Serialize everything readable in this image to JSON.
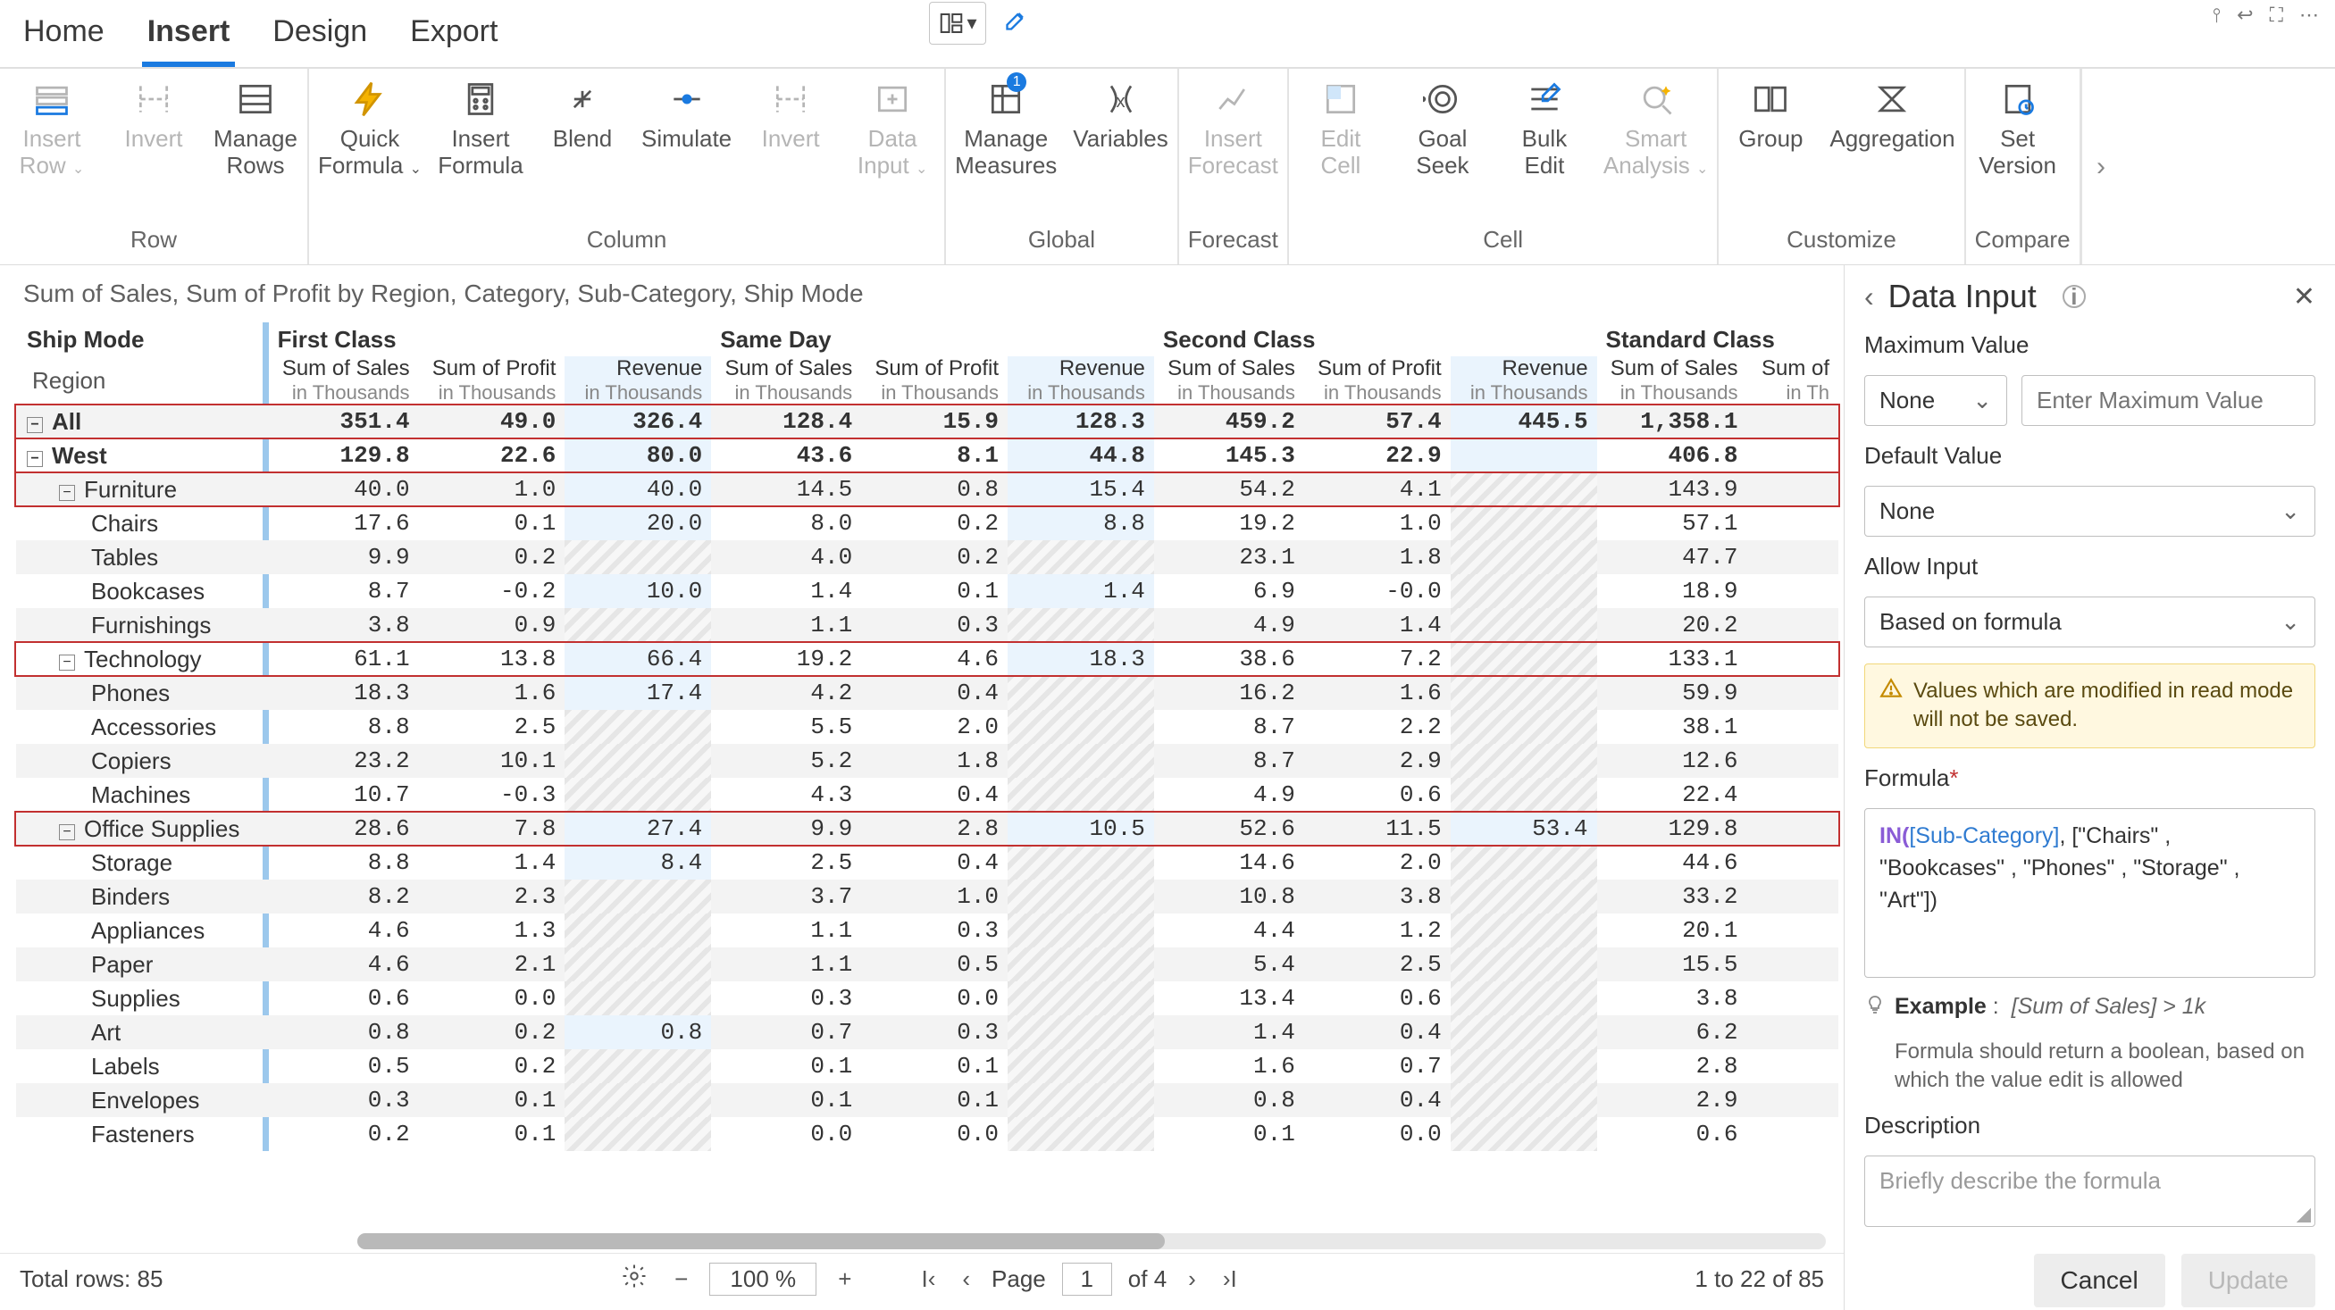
{
  "tabs": [
    "Home",
    "Insert",
    "Design",
    "Export"
  ],
  "activeTab": 1,
  "ribbon": [
    {
      "label": "Row",
      "items": [
        {
          "l1": "Insert",
          "l2": "Row",
          "dd": true,
          "dis": true,
          "icon": "rows"
        },
        {
          "l1": "Invert",
          "l2": "",
          "dis": true,
          "icon": "invert"
        },
        {
          "l1": "Manage",
          "l2": "Rows",
          "icon": "mrows"
        }
      ]
    },
    {
      "label": "Column",
      "items": [
        {
          "l1": "Quick",
          "l2": "Formula",
          "dd": true,
          "icon": "bolt"
        },
        {
          "l1": "Insert",
          "l2": "Formula",
          "icon": "calc"
        },
        {
          "l1": "Blend",
          "l2": "",
          "icon": "blend"
        },
        {
          "l1": "Simulate",
          "l2": "",
          "icon": "sim"
        },
        {
          "l1": "Invert",
          "l2": "",
          "dis": true,
          "icon": "invert"
        },
        {
          "l1": "Data",
          "l2": "Input",
          "dd": true,
          "dis": true,
          "icon": "dinput"
        }
      ]
    },
    {
      "label": "Global",
      "items": [
        {
          "l1": "Manage",
          "l2": "Measures",
          "badge": "1",
          "icon": "mm"
        },
        {
          "l1": "Variables",
          "l2": "",
          "icon": "vars"
        }
      ]
    },
    {
      "label": "Forecast",
      "items": [
        {
          "l1": "Insert",
          "l2": "Forecast",
          "dis": true,
          "icon": "fore"
        }
      ]
    },
    {
      "label": "Cell",
      "items": [
        {
          "l1": "Edit",
          "l2": "Cell",
          "dis": true,
          "icon": "ecell"
        },
        {
          "l1": "Goal",
          "l2": "Seek",
          "icon": "goal"
        },
        {
          "l1": "Bulk",
          "l2": "Edit",
          "icon": "bulk"
        },
        {
          "l1": "Smart",
          "l2": "Analysis",
          "dd": true,
          "dis": true,
          "icon": "smart"
        }
      ]
    },
    {
      "label": "Customize",
      "items": [
        {
          "l1": "Group",
          "l2": "",
          "icon": "group"
        },
        {
          "l1": "Aggregation",
          "l2": "",
          "icon": "agg"
        }
      ]
    },
    {
      "label": "Compare",
      "items": [
        {
          "l1": "Set",
          "l2": "Version",
          "icon": "ver"
        }
      ]
    }
  ],
  "descBar": "Sum of Sales, Sum of Profit by Region, Category, Sub-Category, Ship Mode",
  "bandHeaders": [
    "Ship Mode",
    "First Class",
    "Same Day",
    "Second Class",
    "Standard Class"
  ],
  "colHeadersPerBand": [
    {
      "m": "Sum of Sales",
      "u": "in Thousands"
    },
    {
      "m": "Sum of Profit",
      "u": "in Thousands"
    },
    {
      "m": "Revenue",
      "u": "in Thousands",
      "rev": true
    }
  ],
  "stdCols": [
    {
      "m": "Sum of Sales",
      "u": "in Thousands"
    },
    {
      "m": "Sum of",
      "u": "in Th",
      "truncated": true
    }
  ],
  "rowLabelHeader": "Region",
  "rows": [
    {
      "lbl": "All",
      "ind": 0,
      "exp": "−",
      "bold": true,
      "red": true,
      "striped": true,
      "v": [
        "351.4",
        "49.0",
        "326.4",
        "128.4",
        "15.9",
        "128.3",
        "459.2",
        "57.4",
        "445.5",
        "1,358.1",
        ""
      ]
    },
    {
      "lbl": "West",
      "ind": 0,
      "exp": "−",
      "bold": true,
      "red": true,
      "v": [
        "129.8",
        "22.6",
        "80.0",
        "43.6",
        "8.1",
        "44.8",
        "145.3",
        "22.9",
        "",
        "406.8",
        ""
      ]
    },
    {
      "lbl": "Furniture",
      "ind": 1,
      "exp": "−",
      "bold": false,
      "red": true,
      "striped": true,
      "v": [
        "40.0",
        "1.0",
        "40.0",
        "14.5",
        "0.8",
        "15.4",
        "54.2",
        "4.1",
        "",
        "143.9",
        ""
      ]
    },
    {
      "lbl": "Chairs",
      "ind": 2,
      "v": [
        "17.6",
        "0.1",
        "20.0",
        "8.0",
        "0.2",
        "8.8",
        "19.2",
        "1.0",
        "",
        "57.1",
        ""
      ]
    },
    {
      "lbl": "Tables",
      "ind": 2,
      "striped": true,
      "v": [
        "9.9",
        "0.2",
        "",
        "4.0",
        "0.2",
        "",
        "23.1",
        "1.8",
        "",
        "47.7",
        ""
      ]
    },
    {
      "lbl": "Bookcases",
      "ind": 2,
      "v": [
        "8.7",
        "-0.2",
        "10.0",
        "1.4",
        "0.1",
        "1.4",
        "6.9",
        "-0.0",
        "",
        "18.9",
        ""
      ]
    },
    {
      "lbl": "Furnishings",
      "ind": 2,
      "striped": true,
      "v": [
        "3.8",
        "0.9",
        "",
        "1.1",
        "0.3",
        "",
        "4.9",
        "1.4",
        "",
        "20.2",
        ""
      ]
    },
    {
      "lbl": "Technology",
      "ind": 1,
      "exp": "−",
      "bold": false,
      "red": true,
      "v": [
        "61.1",
        "13.8",
        "66.4",
        "19.2",
        "4.6",
        "18.3",
        "38.6",
        "7.2",
        "",
        "133.1",
        ""
      ]
    },
    {
      "lbl": "Phones",
      "ind": 2,
      "striped": true,
      "v": [
        "18.3",
        "1.6",
        "17.4",
        "4.2",
        "0.4",
        "",
        "16.2",
        "1.6",
        "",
        "59.9",
        ""
      ]
    },
    {
      "lbl": "Accessories",
      "ind": 2,
      "v": [
        "8.8",
        "2.5",
        "",
        "5.5",
        "2.0",
        "",
        "8.7",
        "2.2",
        "",
        "38.1",
        ""
      ]
    },
    {
      "lbl": "Copiers",
      "ind": 2,
      "striped": true,
      "v": [
        "23.2",
        "10.1",
        "",
        "5.2",
        "1.8",
        "",
        "8.7",
        "2.9",
        "",
        "12.6",
        ""
      ]
    },
    {
      "lbl": "Machines",
      "ind": 2,
      "v": [
        "10.7",
        "-0.3",
        "",
        "4.3",
        "0.4",
        "",
        "4.9",
        "0.6",
        "",
        "22.4",
        ""
      ]
    },
    {
      "lbl": "Office Supplies",
      "ind": 1,
      "exp": "−",
      "bold": false,
      "red": true,
      "striped": true,
      "v": [
        "28.6",
        "7.8",
        "27.4",
        "9.9",
        "2.8",
        "10.5",
        "52.6",
        "11.5",
        "53.4",
        "129.8",
        ""
      ]
    },
    {
      "lbl": "Storage",
      "ind": 2,
      "v": [
        "8.8",
        "1.4",
        "8.4",
        "2.5",
        "0.4",
        "",
        "14.6",
        "2.0",
        "",
        "44.6",
        ""
      ]
    },
    {
      "lbl": "Binders",
      "ind": 2,
      "striped": true,
      "v": [
        "8.2",
        "2.3",
        "",
        "3.7",
        "1.0",
        "",
        "10.8",
        "3.8",
        "",
        "33.2",
        ""
      ]
    },
    {
      "lbl": "Appliances",
      "ind": 2,
      "v": [
        "4.6",
        "1.3",
        "",
        "1.1",
        "0.3",
        "",
        "4.4",
        "1.2",
        "",
        "20.1",
        ""
      ]
    },
    {
      "lbl": "Paper",
      "ind": 2,
      "striped": true,
      "v": [
        "4.6",
        "2.1",
        "",
        "1.1",
        "0.5",
        "",
        "5.4",
        "2.5",
        "",
        "15.5",
        ""
      ]
    },
    {
      "lbl": "Supplies",
      "ind": 2,
      "v": [
        "0.6",
        "0.0",
        "",
        "0.3",
        "0.0",
        "",
        "13.4",
        "0.6",
        "",
        "3.8",
        ""
      ]
    },
    {
      "lbl": "Art",
      "ind": 2,
      "striped": true,
      "v": [
        "0.8",
        "0.2",
        "0.8",
        "0.7",
        "0.3",
        "",
        "1.4",
        "0.4",
        "",
        "6.2",
        ""
      ]
    },
    {
      "lbl": "Labels",
      "ind": 2,
      "v": [
        "0.5",
        "0.2",
        "",
        "0.1",
        "0.1",
        "",
        "1.6",
        "0.7",
        "",
        "2.8",
        ""
      ]
    },
    {
      "lbl": "Envelopes",
      "ind": 2,
      "striped": true,
      "v": [
        "0.3",
        "0.1",
        "",
        "0.1",
        "0.1",
        "",
        "0.8",
        "0.4",
        "",
        "2.9",
        ""
      ]
    },
    {
      "lbl": "Fasteners",
      "ind": 2,
      "v": [
        "0.2",
        "0.1",
        "",
        "0.0",
        "0.0",
        "",
        "0.1",
        "0.0",
        "",
        "0.6",
        ""
      ]
    }
  ],
  "status": {
    "totalRows": "Total rows: 85",
    "zoom": "100 %",
    "pageLabel": "Page",
    "pageCur": "1",
    "pageOf": "of 4",
    "rangeText": "1  to  22  of  85"
  },
  "panel": {
    "title": "Data Input",
    "maxLabel": "Maximum Value",
    "maxNone": "None",
    "maxPlaceholder": "Enter Maximum Value",
    "defLabel": "Default Value",
    "defNone": "None",
    "allowLabel": "Allow Input",
    "allowVal": "Based on formula",
    "warn": "Values which are modified in read mode will not be saved.",
    "formulaLabel": "Formula",
    "formulaFn": "IN(",
    "formulaField": "[Sub-Category]",
    "formulaRest": ", [\"Chairs\" , \"Bookcases\" , \"Phones\" , \"Storage\" , \"Art\"])",
    "exLabel": "Example",
    "exCode": "[Sum of Sales] > 1k",
    "exHint": "Formula should return a boolean, based on which the value edit is allowed",
    "descLabel": "Description",
    "descPlaceholder": "Briefly describe the formula",
    "cancel": "Cancel",
    "update": "Update"
  }
}
